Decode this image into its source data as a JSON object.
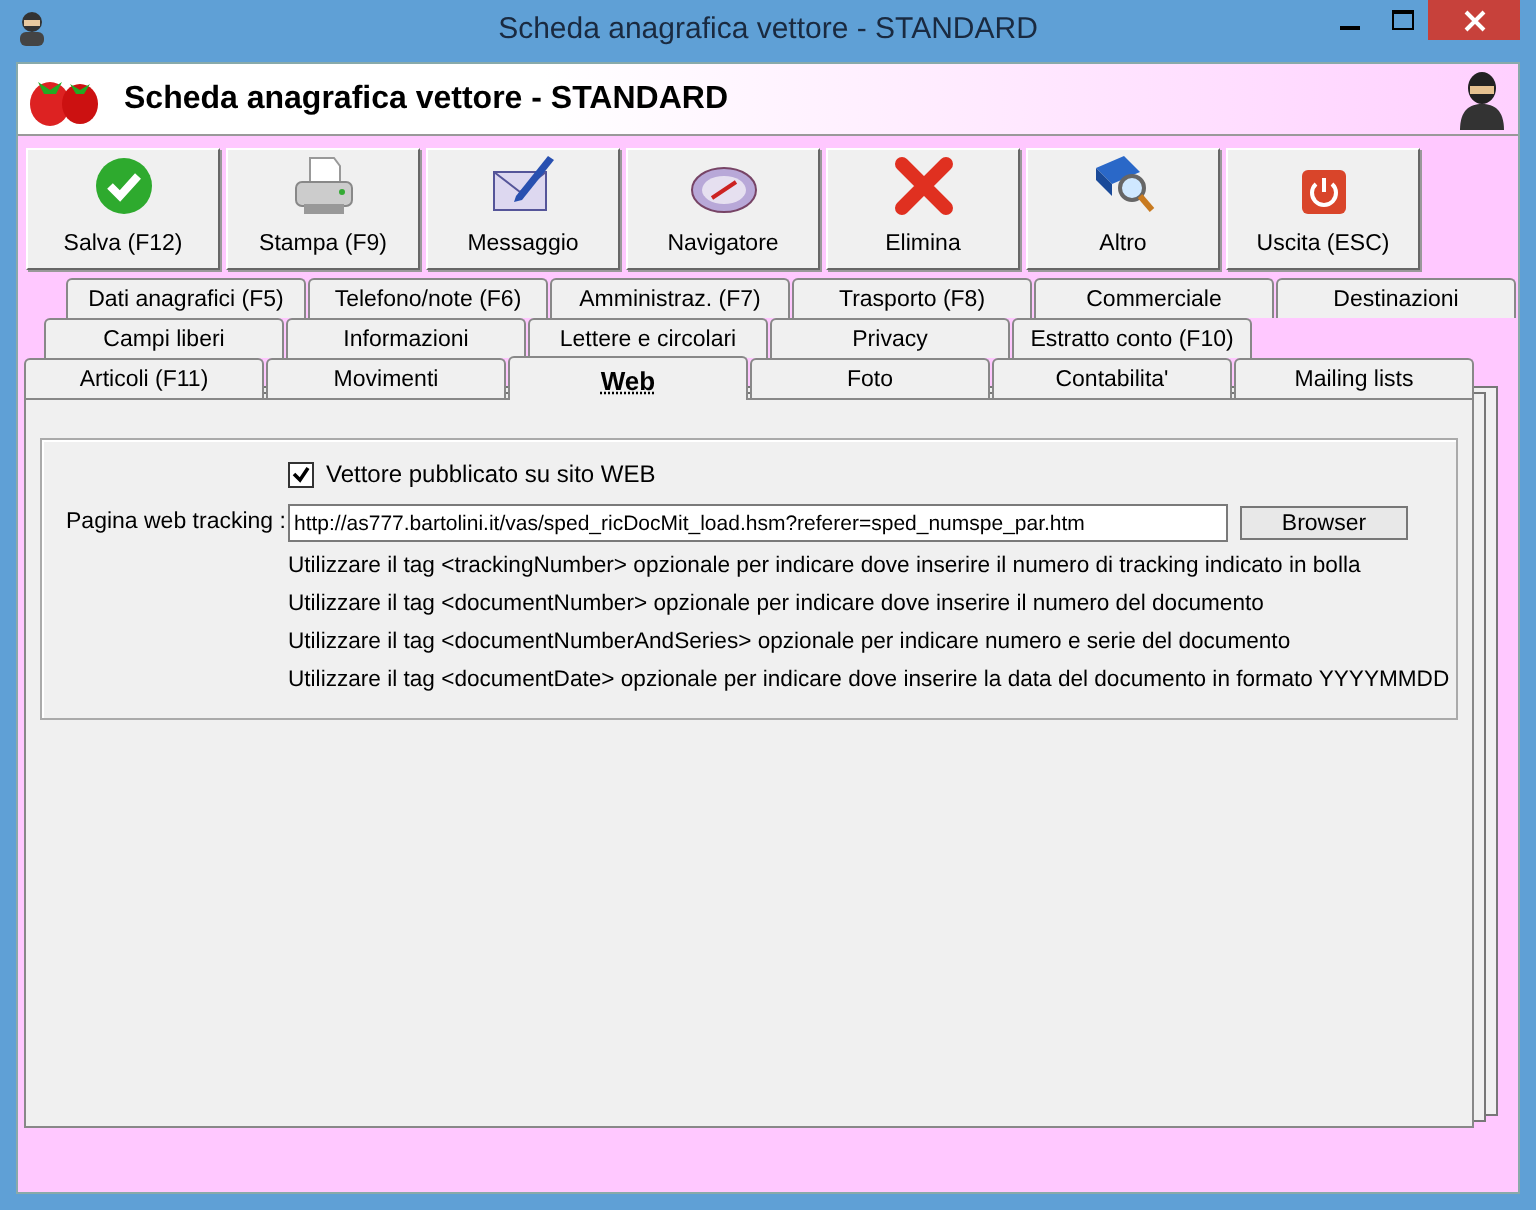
{
  "window": {
    "title": "Scheda anagrafica vettore - STANDARD"
  },
  "header": {
    "title": "Scheda anagrafica vettore - STANDARD"
  },
  "toolbar": [
    {
      "label": "Salva (F12)",
      "kind": "save"
    },
    {
      "label": "Stampa (F9)",
      "kind": "print"
    },
    {
      "label": "Messaggio",
      "kind": "message"
    },
    {
      "label": "Navigatore",
      "kind": "compass"
    },
    {
      "label": "Elimina",
      "kind": "delete"
    },
    {
      "label": "Altro",
      "kind": "search"
    },
    {
      "label": "Uscita (ESC)",
      "kind": "exit"
    }
  ],
  "tab_rows": [
    [
      {
        "label": "Dati anagrafici (F5)",
        "selected": false
      },
      {
        "label": "Telefono/note (F6)",
        "selected": false
      },
      {
        "label": "Amministraz. (F7)",
        "selected": false
      },
      {
        "label": "Trasporto (F8)",
        "selected": false
      },
      {
        "label": "Commerciale",
        "selected": false
      },
      {
        "label": "Destinazioni",
        "selected": false
      }
    ],
    [
      {
        "label": "Campi liberi",
        "selected": false
      },
      {
        "label": "Informazioni",
        "selected": false
      },
      {
        "label": "Lettere e circolari",
        "selected": false
      },
      {
        "label": "Privacy",
        "selected": false
      },
      {
        "label": "Estratto conto (F10)",
        "selected": false
      }
    ],
    [
      {
        "label": "Articoli (F11)",
        "selected": false
      },
      {
        "label": "Movimenti",
        "selected": false
      },
      {
        "label": "Web",
        "selected": true
      },
      {
        "label": "Foto",
        "selected": false
      },
      {
        "label": "Contabilita'",
        "selected": false
      },
      {
        "label": "Mailing lists",
        "selected": false
      }
    ]
  ],
  "web": {
    "published": {
      "label": "Vettore pubblicato su sito WEB",
      "checked": true
    },
    "tracking": {
      "label": "Pagina web tracking :",
      "value": "http://as777.bartolini.it/vas/sped_ricDocMit_load.hsm?referer=sped_numspe_par.htm",
      "button": "Browser"
    },
    "notes": [
      "Utilizzare il tag <trackingNumber> opzionale per indicare dove inserire il numero di tracking indicato in bolla",
      "Utilizzare il tag <documentNumber> opzionale per indicare dove inserire il numero del documento",
      "Utilizzare il tag <documentNumberAndSeries> opzionale per indicare numero e serie del documento",
      "Utilizzare il tag <documentDate> opzionale per indicare dove inserire la data del documento in formato YYYYMMDD"
    ]
  }
}
